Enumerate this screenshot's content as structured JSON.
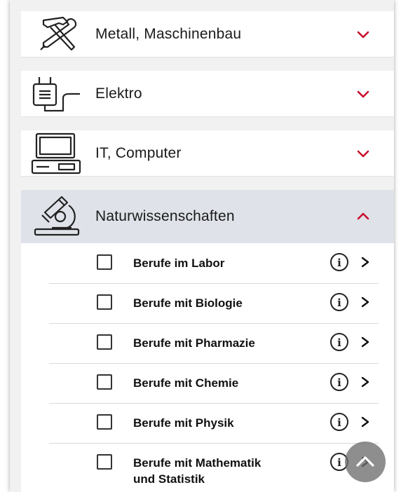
{
  "categories": [
    {
      "label": "Metall, Maschinenbau",
      "icon": "hammer-wrench-icon",
      "expanded": false
    },
    {
      "label": "Elektro",
      "icon": "plug-icon",
      "expanded": false
    },
    {
      "label": "IT, Computer",
      "icon": "computer-icon",
      "expanded": false
    },
    {
      "label": "Naturwissenschaften",
      "icon": "microscope-icon",
      "expanded": true
    }
  ],
  "subitems": [
    {
      "label": "Berufe im Labor",
      "checked": false
    },
    {
      "label": "Berufe mit Biologie",
      "checked": false
    },
    {
      "label": "Berufe mit Pharmazie",
      "checked": false
    },
    {
      "label": "Berufe mit Chemie",
      "checked": false
    },
    {
      "label": "Berufe mit Physik",
      "checked": false
    },
    {
      "label_line1": "Berufe mit Mathematik",
      "label_line2": "und Statistik",
      "checked": false
    }
  ],
  "colors": {
    "accent": "#c8102e",
    "expanded_bg": "#dfe2e8",
    "page_bg": "#f1f1f2"
  },
  "icons": {
    "info": "info-circle-icon",
    "row_arrow": "chevron-right-icon",
    "scroll_top": "scroll-to-top-button"
  }
}
